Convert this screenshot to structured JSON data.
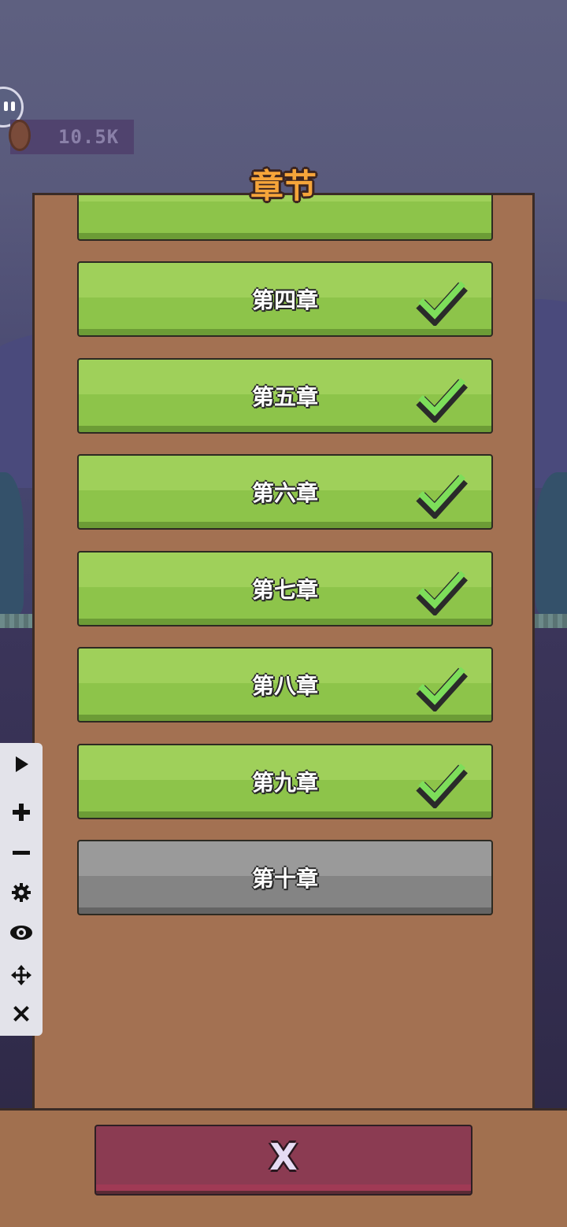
{
  "hud": {
    "coins": "10.5K",
    "coin_icon": "coin-icon",
    "pet_icon": "pet-face-icon"
  },
  "dialog": {
    "title": "章节",
    "chapters": [
      {
        "label": "",
        "completed": true
      },
      {
        "label": "第四章",
        "completed": true
      },
      {
        "label": "第五章",
        "completed": true
      },
      {
        "label": "第六章",
        "completed": true
      },
      {
        "label": "第七章",
        "completed": true
      },
      {
        "label": "第八章",
        "completed": true
      },
      {
        "label": "第九章",
        "completed": true
      },
      {
        "label": "第十章",
        "completed": false
      }
    ],
    "close_label": "X"
  },
  "toolbar": {
    "items": [
      "play-icon",
      "plus-icon",
      "minus-icon",
      "gear-icon",
      "eye-icon",
      "move-icon",
      "close-icon"
    ]
  },
  "colors": {
    "panel": "#a37152",
    "chapter_done": "#8dc44a",
    "chapter_locked": "#848484",
    "title": "#f6a53a",
    "close_button": "#8b3b52"
  }
}
